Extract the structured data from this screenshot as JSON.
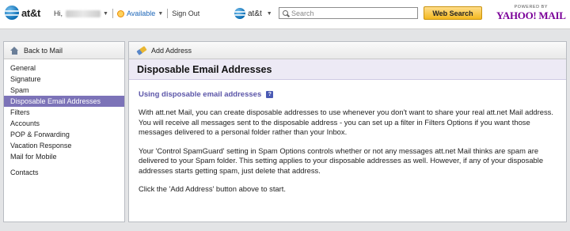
{
  "header": {
    "logo_text": "at&t",
    "greeting": "Hi,",
    "status": "Available",
    "sign_out": "Sign Out",
    "brand_menu": "at&t",
    "search_placeholder": "Search",
    "web_search_label": "Web Search",
    "powered_by": "POWERED BY",
    "yahoo_mail": "YAHOO! MAIL"
  },
  "sidebar": {
    "back_label": "Back to Mail",
    "items": [
      {
        "label": "General",
        "active": false
      },
      {
        "label": "Signature",
        "active": false
      },
      {
        "label": "Spam",
        "active": false
      },
      {
        "label": "Disposable Email Addresses",
        "active": true
      },
      {
        "label": "Filters",
        "active": false
      },
      {
        "label": "Accounts",
        "active": false
      },
      {
        "label": "POP & Forwarding",
        "active": false
      },
      {
        "label": "Vacation Response",
        "active": false
      },
      {
        "label": "Mail for Mobile",
        "active": false
      },
      {
        "label": "Contacts",
        "active": false
      }
    ]
  },
  "main": {
    "toolbar_add_label": "Add Address",
    "title": "Disposable Email Addresses",
    "section_heading": "Using disposable email addresses",
    "help_glyph": "?",
    "paragraphs": [
      "With att.net Mail, you can create disposable addresses to use whenever you don't want to share your real att.net Mail address. You will receive all messages sent to the disposable address - you can set up a filter in Filters Options if you want those messages delivered to a personal folder rather than your Inbox.",
      "Your 'Control SpamGuard' setting in Spam Options controls whether or not any messages att.net Mail thinks are spam are delivered to your Spam folder. This setting applies to your disposable addresses as well. However, if any of your disposable addresses starts getting spam, just delete that address.",
      "Click the 'Add Address' button above to start."
    ]
  },
  "colors": {
    "active_nav": "#7c73b8",
    "section_heading": "#5b55a8",
    "title_bar": "#edeaf5",
    "web_search_button": "#f3b81f",
    "yahoo_purple": "#7b0099",
    "status_link": "#1d66b8"
  },
  "icons": [
    "att-globe-icon",
    "status-smiley-icon",
    "chevron-down-icon",
    "search-icon",
    "home-icon",
    "add-address-icon",
    "help-icon"
  ]
}
